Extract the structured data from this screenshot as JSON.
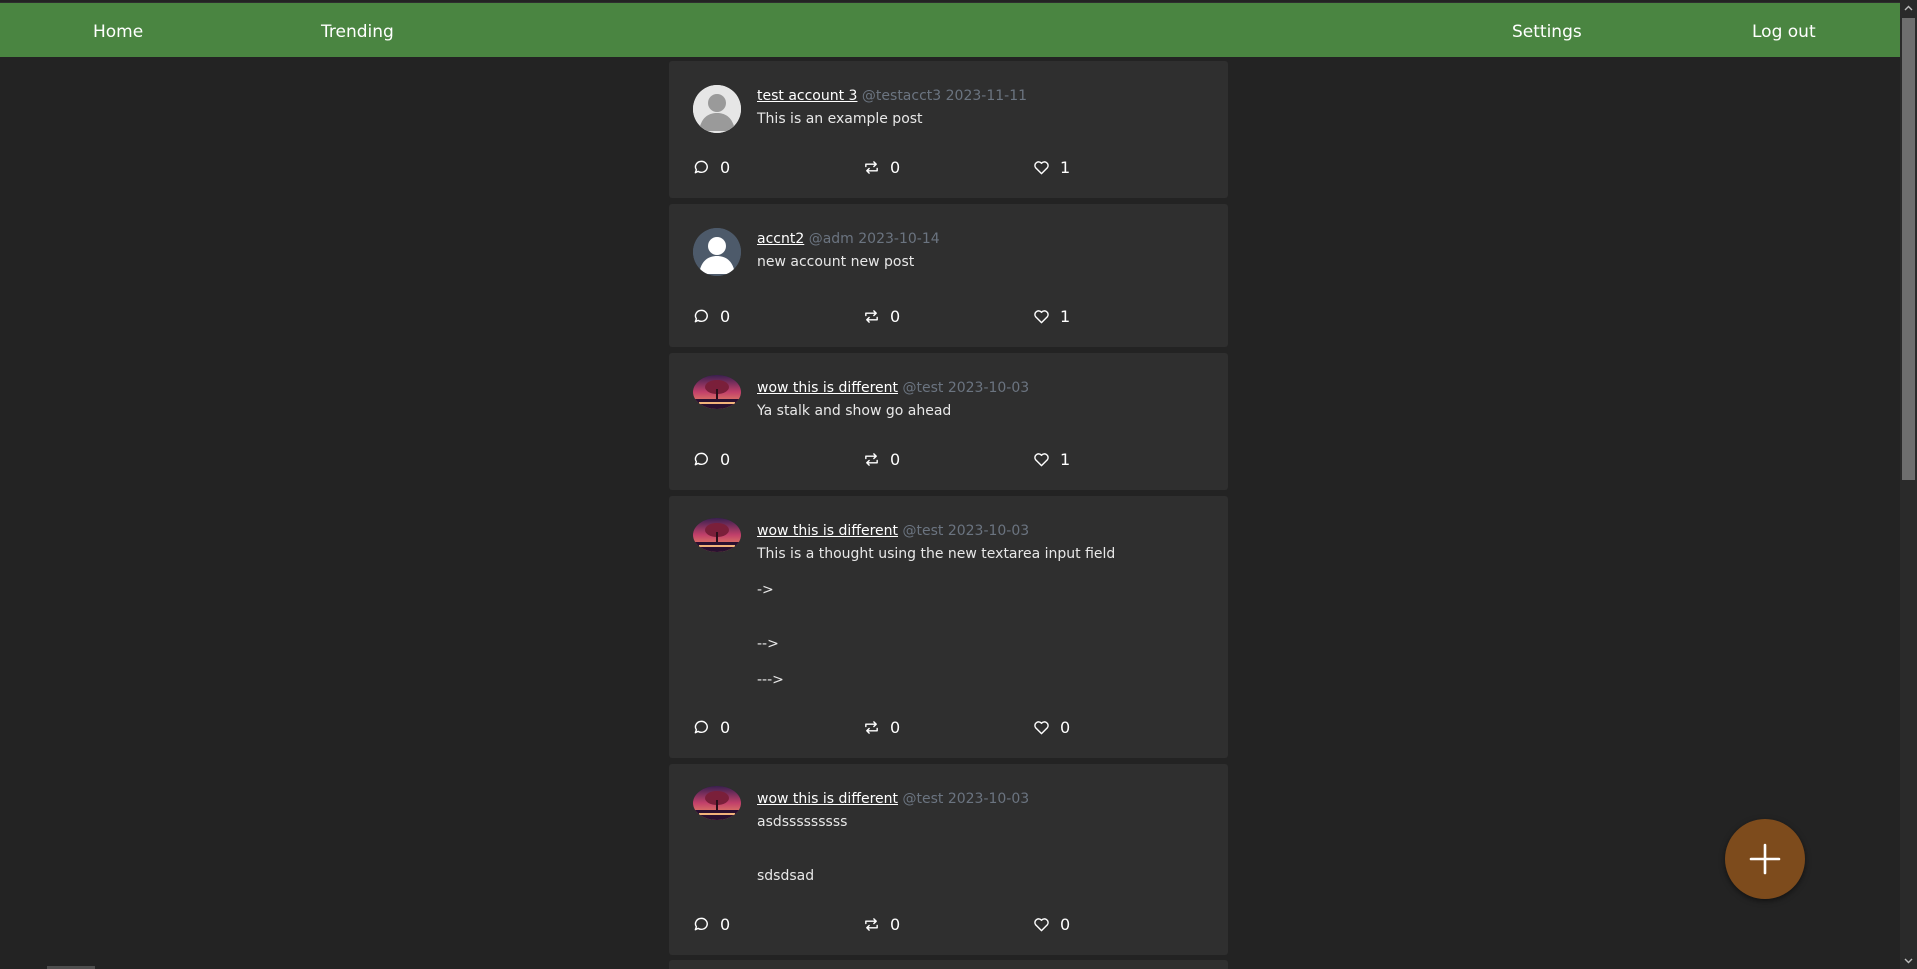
{
  "nav": {
    "home": "Home",
    "trending": "Trending",
    "settings": "Settings",
    "logout": "Log out"
  },
  "posts": [
    {
      "author": "test account 3",
      "handle": "@testacct3",
      "date": "2023-11-11",
      "avatar": "default-user-light",
      "body": "This is an example post",
      "comments": "0",
      "reposts": "0",
      "likes": "1"
    },
    {
      "author": "accnt2",
      "handle": "@adm",
      "date": "2023-10-14",
      "avatar": "default-user-dark",
      "body": "new account new post",
      "comments": "0",
      "reposts": "0",
      "likes": "1"
    },
    {
      "author": "wow this is different",
      "handle": "@test",
      "date": "2023-10-03",
      "avatar": "sunset-tree-photo",
      "body": "Ya stalk and show go ahead",
      "comments": "0",
      "reposts": "0",
      "likes": "1"
    },
    {
      "author": "wow this is different",
      "handle": "@test",
      "date": "2023-10-03",
      "avatar": "sunset-tree-photo",
      "body": "This is a thought using the new textarea input field\n\n->\n\n\n-->\n\n--->",
      "comments": "0",
      "reposts": "0",
      "likes": "0"
    },
    {
      "author": "wow this is different",
      "handle": "@test",
      "date": "2023-10-03",
      "avatar": "sunset-tree-photo",
      "body": "asdsssssssss\n\n\nsdsdsad",
      "comments": "0",
      "reposts": "0",
      "likes": "0"
    }
  ],
  "icons": {
    "comment": "comment-icon",
    "repost": "repost-icon",
    "like": "heart-icon",
    "new_post": "plus-icon"
  },
  "colors": {
    "nav_bg": "#4a8541",
    "page_bg": "#232323",
    "card_bg": "#2f2f2f",
    "fab_bg": "#7d4b1c",
    "muted_text": "#6b7480"
  }
}
